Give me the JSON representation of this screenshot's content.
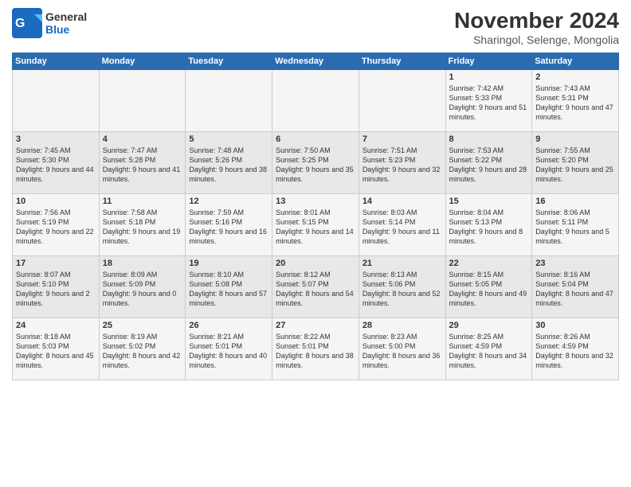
{
  "logo": {
    "general": "General",
    "blue": "Blue"
  },
  "title": "November 2024",
  "location": "Sharingol, Selenge, Mongolia",
  "days_of_week": [
    "Sunday",
    "Monday",
    "Tuesday",
    "Wednesday",
    "Thursday",
    "Friday",
    "Saturday"
  ],
  "weeks": [
    [
      {
        "day": "",
        "info": ""
      },
      {
        "day": "",
        "info": ""
      },
      {
        "day": "",
        "info": ""
      },
      {
        "day": "",
        "info": ""
      },
      {
        "day": "",
        "info": ""
      },
      {
        "day": "1",
        "info": "Sunrise: 7:42 AM\nSunset: 5:33 PM\nDaylight: 9 hours and 51 minutes."
      },
      {
        "day": "2",
        "info": "Sunrise: 7:43 AM\nSunset: 5:31 PM\nDaylight: 9 hours and 47 minutes."
      }
    ],
    [
      {
        "day": "3",
        "info": "Sunrise: 7:45 AM\nSunset: 5:30 PM\nDaylight: 9 hours and 44 minutes."
      },
      {
        "day": "4",
        "info": "Sunrise: 7:47 AM\nSunset: 5:28 PM\nDaylight: 9 hours and 41 minutes."
      },
      {
        "day": "5",
        "info": "Sunrise: 7:48 AM\nSunset: 5:26 PM\nDaylight: 9 hours and 38 minutes."
      },
      {
        "day": "6",
        "info": "Sunrise: 7:50 AM\nSunset: 5:25 PM\nDaylight: 9 hours and 35 minutes."
      },
      {
        "day": "7",
        "info": "Sunrise: 7:51 AM\nSunset: 5:23 PM\nDaylight: 9 hours and 32 minutes."
      },
      {
        "day": "8",
        "info": "Sunrise: 7:53 AM\nSunset: 5:22 PM\nDaylight: 9 hours and 28 minutes."
      },
      {
        "day": "9",
        "info": "Sunrise: 7:55 AM\nSunset: 5:20 PM\nDaylight: 9 hours and 25 minutes."
      }
    ],
    [
      {
        "day": "10",
        "info": "Sunrise: 7:56 AM\nSunset: 5:19 PM\nDaylight: 9 hours and 22 minutes."
      },
      {
        "day": "11",
        "info": "Sunrise: 7:58 AM\nSunset: 5:18 PM\nDaylight: 9 hours and 19 minutes."
      },
      {
        "day": "12",
        "info": "Sunrise: 7:59 AM\nSunset: 5:16 PM\nDaylight: 9 hours and 16 minutes."
      },
      {
        "day": "13",
        "info": "Sunrise: 8:01 AM\nSunset: 5:15 PM\nDaylight: 9 hours and 14 minutes."
      },
      {
        "day": "14",
        "info": "Sunrise: 8:03 AM\nSunset: 5:14 PM\nDaylight: 9 hours and 11 minutes."
      },
      {
        "day": "15",
        "info": "Sunrise: 8:04 AM\nSunset: 5:13 PM\nDaylight: 9 hours and 8 minutes."
      },
      {
        "day": "16",
        "info": "Sunrise: 8:06 AM\nSunset: 5:11 PM\nDaylight: 9 hours and 5 minutes."
      }
    ],
    [
      {
        "day": "17",
        "info": "Sunrise: 8:07 AM\nSunset: 5:10 PM\nDaylight: 9 hours and 2 minutes."
      },
      {
        "day": "18",
        "info": "Sunrise: 8:09 AM\nSunset: 5:09 PM\nDaylight: 9 hours and 0 minutes."
      },
      {
        "day": "19",
        "info": "Sunrise: 8:10 AM\nSunset: 5:08 PM\nDaylight: 8 hours and 57 minutes."
      },
      {
        "day": "20",
        "info": "Sunrise: 8:12 AM\nSunset: 5:07 PM\nDaylight: 8 hours and 54 minutes."
      },
      {
        "day": "21",
        "info": "Sunrise: 8:13 AM\nSunset: 5:06 PM\nDaylight: 8 hours and 52 minutes."
      },
      {
        "day": "22",
        "info": "Sunrise: 8:15 AM\nSunset: 5:05 PM\nDaylight: 8 hours and 49 minutes."
      },
      {
        "day": "23",
        "info": "Sunrise: 8:16 AM\nSunset: 5:04 PM\nDaylight: 8 hours and 47 minutes."
      }
    ],
    [
      {
        "day": "24",
        "info": "Sunrise: 8:18 AM\nSunset: 5:03 PM\nDaylight: 8 hours and 45 minutes."
      },
      {
        "day": "25",
        "info": "Sunrise: 8:19 AM\nSunset: 5:02 PM\nDaylight: 8 hours and 42 minutes."
      },
      {
        "day": "26",
        "info": "Sunrise: 8:21 AM\nSunset: 5:01 PM\nDaylight: 8 hours and 40 minutes."
      },
      {
        "day": "27",
        "info": "Sunrise: 8:22 AM\nSunset: 5:01 PM\nDaylight: 8 hours and 38 minutes."
      },
      {
        "day": "28",
        "info": "Sunrise: 8:23 AM\nSunset: 5:00 PM\nDaylight: 8 hours and 36 minutes."
      },
      {
        "day": "29",
        "info": "Sunrise: 8:25 AM\nSunset: 4:59 PM\nDaylight: 8 hours and 34 minutes."
      },
      {
        "day": "30",
        "info": "Sunrise: 8:26 AM\nSunset: 4:59 PM\nDaylight: 8 hours and 32 minutes."
      }
    ]
  ]
}
